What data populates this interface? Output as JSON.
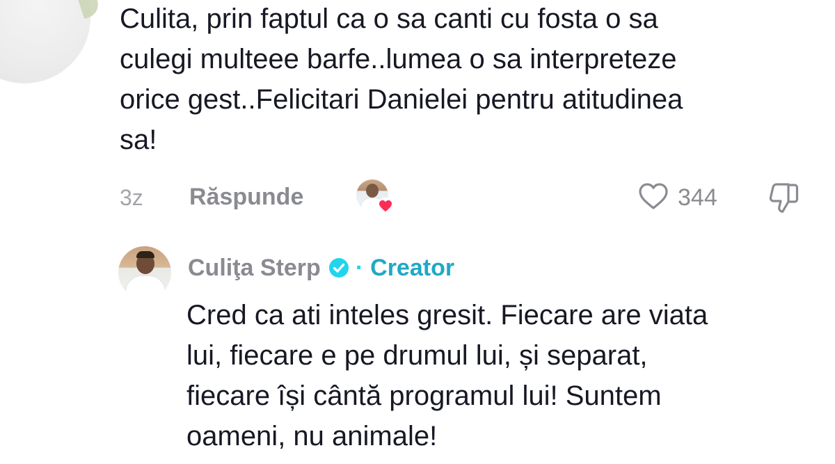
{
  "comment": {
    "text": "Culita, prin faptul ca o sa canti cu fosta o sa\nculegi multeee barfe..lumea o sa interpreteze\norice gest..Felicitari Danielei pentru atitudinea\nsa!",
    "timestamp": "3z",
    "reply_label": "Răspunde",
    "like_count": "344",
    "liked_by_creator": true
  },
  "reply": {
    "author": "Culiţa Sterp",
    "verified": true,
    "separator": "·",
    "badge": "Creator",
    "text": "Cred ca ati inteles gresit. Fiecare are viata\nlui, fiecare e pe drumul lui, și separat,\nfiecare își cântă programul lui! Suntem\noameni, nu animale!"
  },
  "icons": {
    "like": "heart-outline-icon",
    "dislike": "thumbs-down-icon",
    "verified": "verified-check-icon",
    "creator_heart": "heart-filled-icon"
  },
  "colors": {
    "text_primary": "#161823",
    "text_secondary": "#8a8b91",
    "creator_accent": "#1fa9c6",
    "verified_blue": "#20d5ec",
    "heart_red": "#fe2c55"
  }
}
